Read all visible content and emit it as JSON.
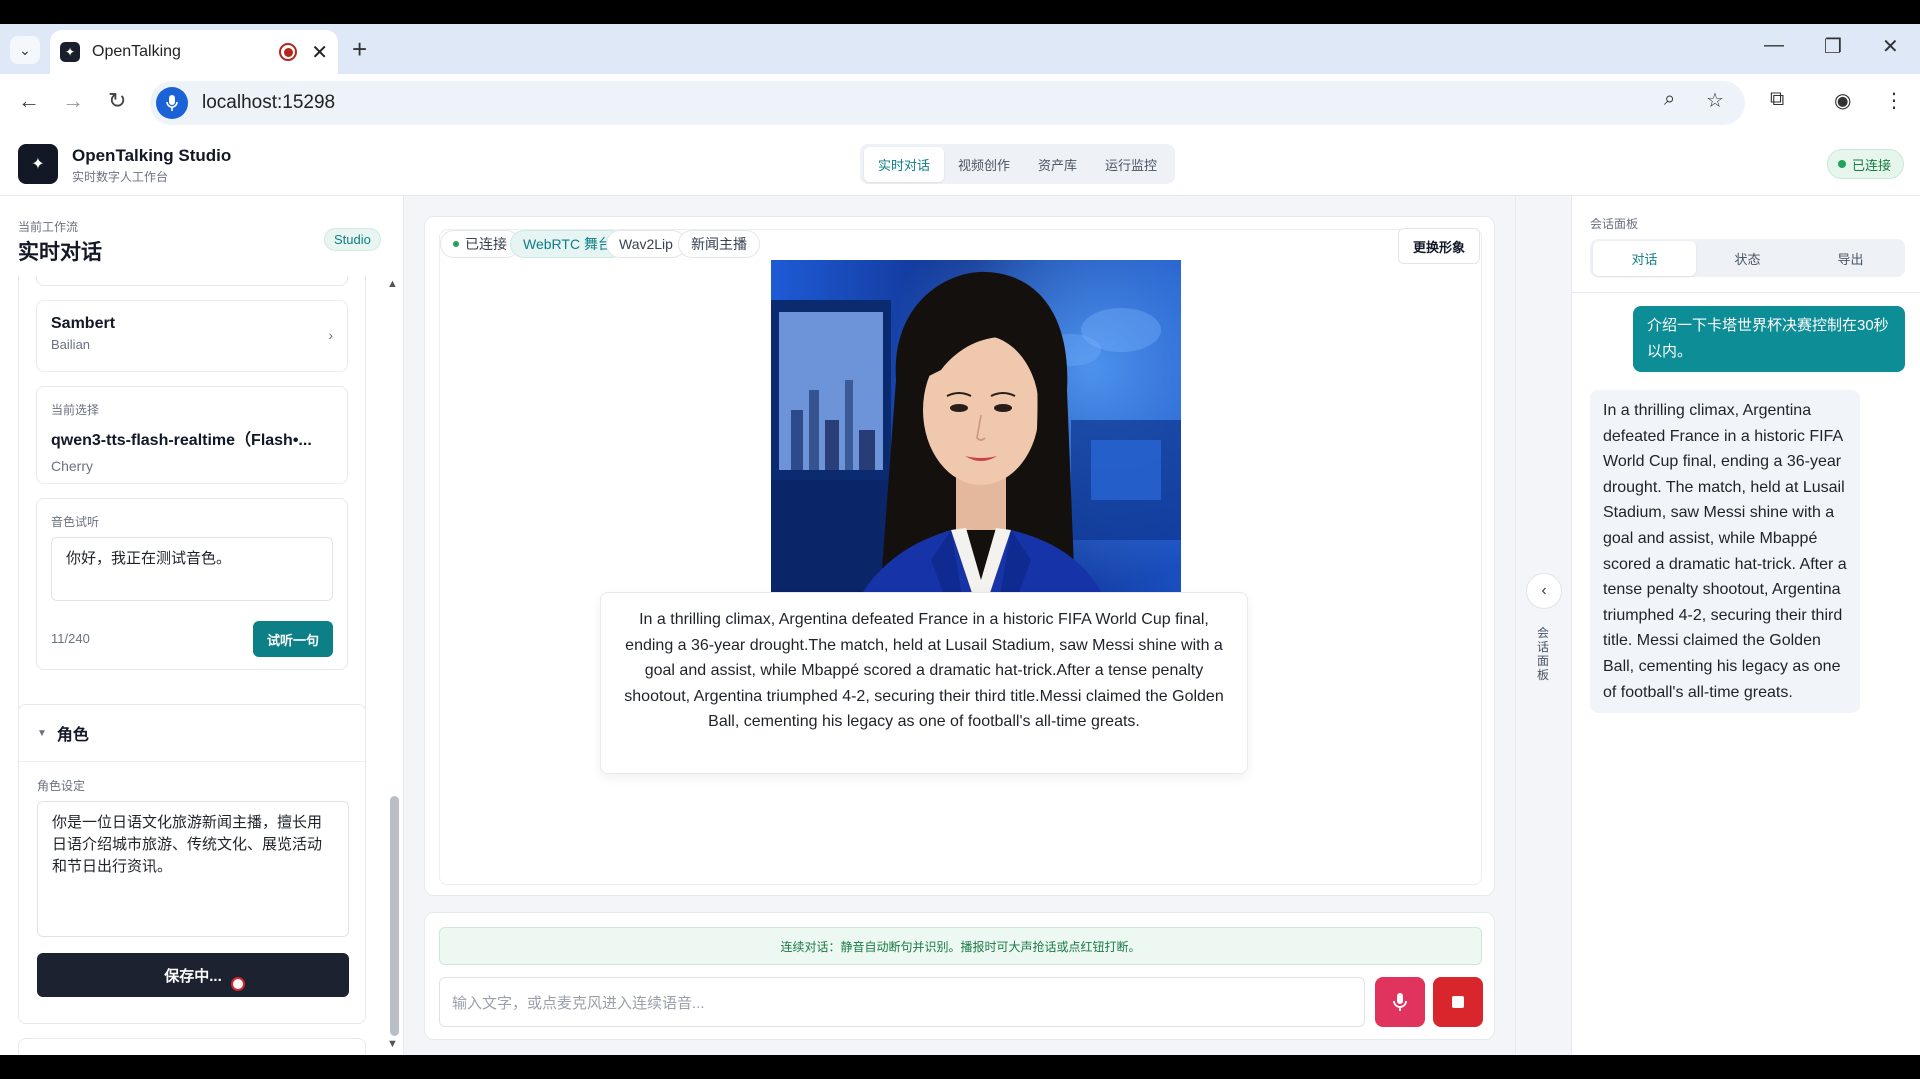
{
  "browser": {
    "tab_title": "OpenTalking",
    "url": "localhost:15298"
  },
  "app": {
    "title": "OpenTalking Studio",
    "subtitle": "实时数字人工作台",
    "nav": [
      "实时对话",
      "视频创作",
      "资产库",
      "运行监控"
    ],
    "active_nav": "实时对话",
    "status": "已连接"
  },
  "left": {
    "workflow_label": "当前工作流",
    "workflow_title": "实时对话",
    "badge": "Studio",
    "voice_card": {
      "name": "Sambert",
      "provider": "Bailian"
    },
    "current": {
      "label": "当前选择",
      "name": "qwen3-tts-flash-realtime（Flash•...",
      "voice": "Cherry"
    },
    "preview": {
      "label": "音色试听",
      "text": "你好，我正在测试音色。",
      "count": "11/240",
      "button": "试听一句"
    },
    "role": {
      "section": "角色",
      "label": "角色设定",
      "text": "你是一位日语文化旅游新闻主播，擅长用日语介绍城市旅游、传统文化、展览活动和节日出行资讯。",
      "save_button": "保存中..."
    }
  },
  "stage": {
    "chips": [
      "已连接",
      "WebRTC 舞台",
      "Wav2Lip",
      "新闻主播"
    ],
    "swap_button": "更换形象",
    "subtitle": "In a thrilling climax, Argentina defeated France in a historic FIFA World Cup final, ending a 36-year drought.The match, held at Lusail Stadium, saw Messi shine with a goal and assist, while Mbappé scored a dramatic hat-trick.After a tense penalty shootout, Argentina triumphed 4-2, securing their third title.Messi claimed the Golden Ball, cementing his legacy as one of football's all-time greats."
  },
  "input": {
    "hint": "连续对话：静音自动断句并识别。播报时可大声抢话或点红钮打断。",
    "placeholder": "输入文字，或点麦克风进入连续语音..."
  },
  "collapse_label": "会话面板",
  "right": {
    "panel_label": "会话面板",
    "tabs": [
      "对话",
      "状态",
      "导出"
    ],
    "user_msg": "介绍一下卡塔世界杯决赛控制在30秒以内。",
    "bot_msg": "In a thrilling climax, Argentina defeated France in a historic FIFA World Cup final, ending a 36-year drought. The match, held at Lusail Stadium, saw Messi shine with a goal and assist, while Mbappé scored a dramatic hat-trick. After a tense penalty shootout, Argentina triumphed 4-2, securing their third title. Messi claimed the Golden Ball, cementing his legacy as one of football's all-time greats."
  },
  "colors": {
    "accent": "#0d7f86",
    "danger": "#d9252c",
    "mic": "#e0345e",
    "success": "#22a35a"
  }
}
